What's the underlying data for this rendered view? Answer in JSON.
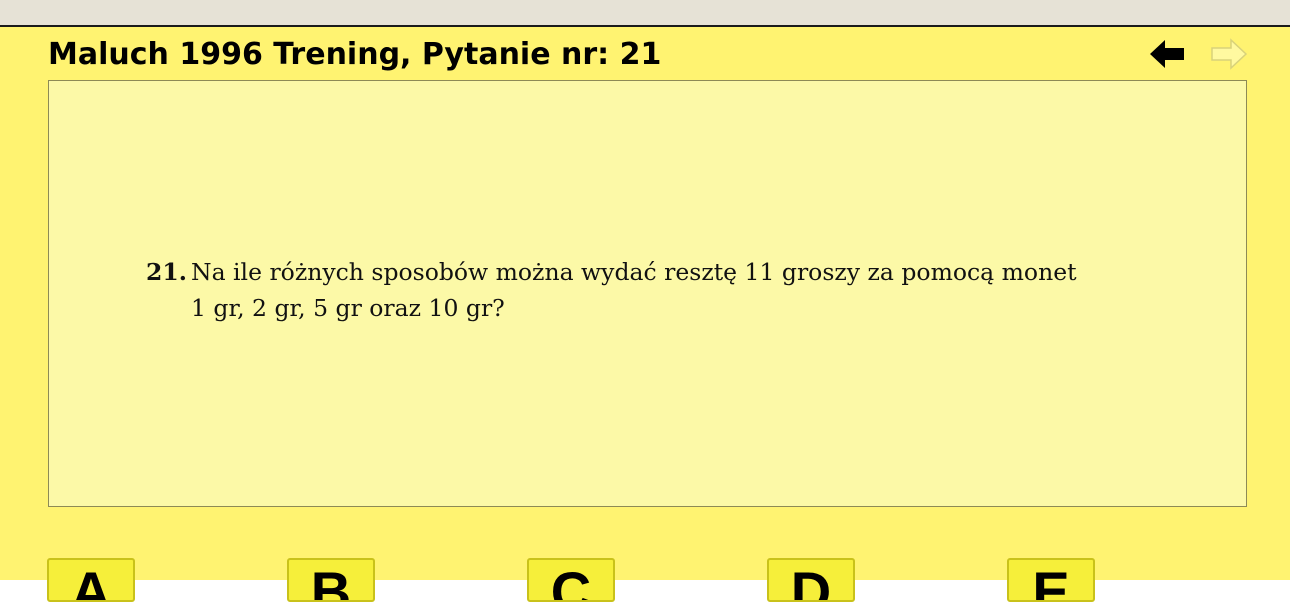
{
  "header": {
    "title": "Maluch 1996 Trening, Pytanie nr: 21"
  },
  "navigation": {
    "prev_icon": "arrow-left-icon",
    "next_icon": "arrow-right-icon",
    "prev_color": "#000000",
    "next_color": "#fff9a0"
  },
  "question": {
    "number": "21.",
    "line1": "Na ile różnych sposobów można wydać resztę 11 groszy za pomocą monet",
    "line2": "1 gr, 2 gr, 5 gr oraz 10 gr?"
  },
  "answers": [
    {
      "label": "A"
    },
    {
      "label": "B"
    },
    {
      "label": "C"
    },
    {
      "label": "D"
    },
    {
      "label": "E"
    }
  ],
  "colors": {
    "page_background": "#fff371",
    "question_background": "#fcf9a7",
    "answer_background": "#f6ef3a"
  }
}
